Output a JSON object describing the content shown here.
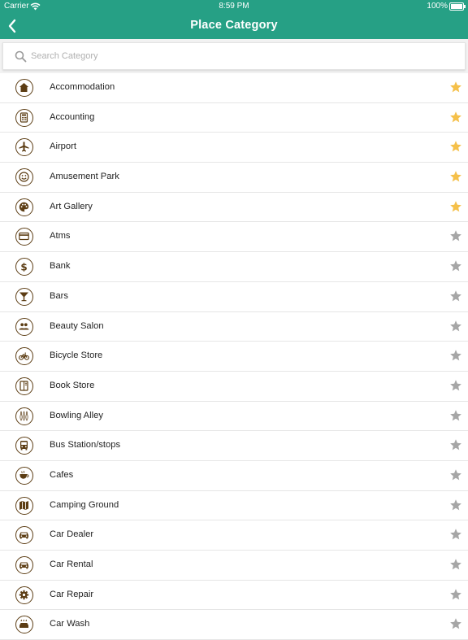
{
  "status_bar": {
    "carrier": "Carrier",
    "time": "8:59 PM",
    "battery": "100%"
  },
  "nav": {
    "title": "Place Category",
    "back_icon": "chevron-left-icon"
  },
  "search": {
    "placeholder": "Search Category",
    "value": ""
  },
  "colors": {
    "header": "#26a085",
    "icon_brown": "#5c3d14",
    "star_favorite": "#f5c04a",
    "star_default": "#a6a6a6"
  },
  "categories": [
    {
      "label": "Accommodation",
      "icon": "home-icon",
      "favorite": true
    },
    {
      "label": "Accounting",
      "icon": "calculator-icon",
      "favorite": true
    },
    {
      "label": "Airport",
      "icon": "airplane-icon",
      "favorite": true
    },
    {
      "label": "Amusement Park",
      "icon": "smiley-icon",
      "favorite": true
    },
    {
      "label": "Art Gallery",
      "icon": "palette-icon",
      "favorite": true
    },
    {
      "label": "Atms",
      "icon": "credit-card-icon",
      "favorite": false
    },
    {
      "label": "Bank",
      "icon": "dollar-icon",
      "favorite": false
    },
    {
      "label": "Bars",
      "icon": "cocktail-icon",
      "favorite": false
    },
    {
      "label": "Beauty Salon",
      "icon": "people-icon",
      "favorite": false
    },
    {
      "label": "Bicycle Store",
      "icon": "bicycle-icon",
      "favorite": false
    },
    {
      "label": "Book Store",
      "icon": "book-icon",
      "favorite": false
    },
    {
      "label": "Bowling Alley",
      "icon": "bowling-icon",
      "favorite": false
    },
    {
      "label": "Bus Station/stops",
      "icon": "bus-icon",
      "favorite": false
    },
    {
      "label": "Cafes",
      "icon": "coffee-icon",
      "favorite": false
    },
    {
      "label": "Camping Ground",
      "icon": "map-icon",
      "favorite": false
    },
    {
      "label": "Car Dealer",
      "icon": "car-icon",
      "favorite": false
    },
    {
      "label": "Car Rental",
      "icon": "car-front-icon",
      "favorite": false
    },
    {
      "label": "Car Repair",
      "icon": "gear-icon",
      "favorite": false
    },
    {
      "label": "Car Wash",
      "icon": "car-wash-icon",
      "favorite": false
    }
  ]
}
